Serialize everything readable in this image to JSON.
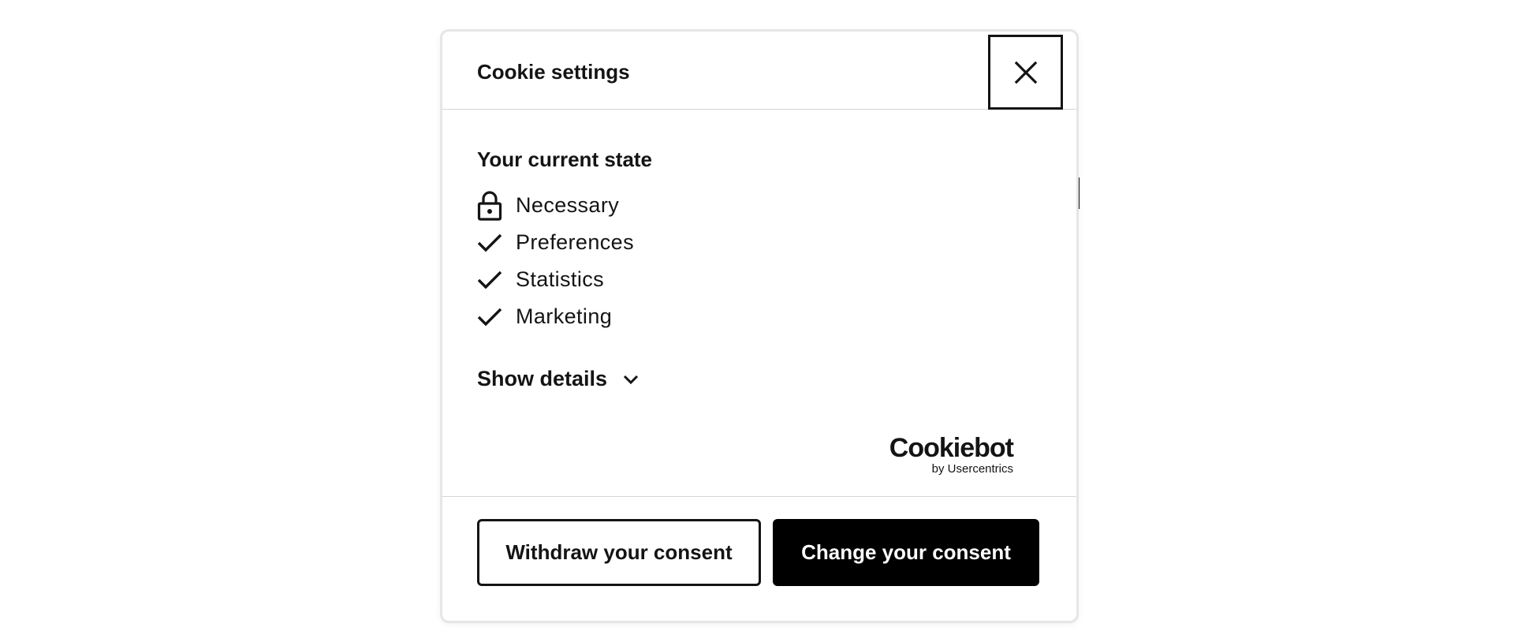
{
  "dialog": {
    "title": "Cookie settings",
    "close_icon": "close-icon"
  },
  "current_state": {
    "heading": "Your current state",
    "items": [
      {
        "label": "Necessary",
        "icon": "lock-icon"
      },
      {
        "label": "Preferences",
        "icon": "checkmark-icon"
      },
      {
        "label": "Statistics",
        "icon": "checkmark-icon"
      },
      {
        "label": "Marketing",
        "icon": "checkmark-icon"
      }
    ]
  },
  "details": {
    "label": "Show details",
    "icon": "chevron-down-icon"
  },
  "brand": {
    "name": "Cookiebot",
    "sub": "by Usercentrics"
  },
  "actions": {
    "withdraw_label": "Withdraw your consent",
    "change_label": "Change your consent"
  },
  "colors": {
    "text": "#141414",
    "primary_button_bg": "#000000",
    "primary_button_text": "#ffffff",
    "divider": "#d6d6d6"
  }
}
